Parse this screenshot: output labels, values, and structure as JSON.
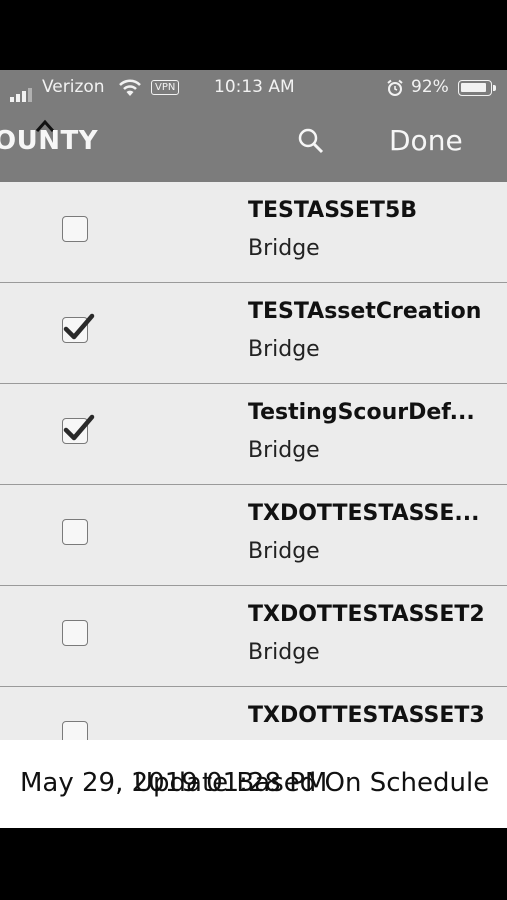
{
  "status_bar": {
    "carrier": "Verizon",
    "vpn": "VPN",
    "time": "10:13 AM",
    "battery_pct": "92%",
    "battery_level": 0.92
  },
  "nav": {
    "title": "OUNTY",
    "done_label": "Done"
  },
  "rows": [
    {
      "name": "TESTASSET5B",
      "type": "Bridge",
      "checked": false
    },
    {
      "name": "TESTAssetCreation",
      "type": "Bridge",
      "checked": true
    },
    {
      "name": "TestingScourDef...",
      "type": "Bridge",
      "checked": true
    },
    {
      "name": "TXDOTTESTASSE...",
      "type": "Bridge",
      "checked": false
    },
    {
      "name": "TXDOTTESTASSET2",
      "type": "Bridge",
      "checked": false
    },
    {
      "name": "TXDOTTESTASSET3",
      "type": "",
      "checked": false
    }
  ],
  "footer": {
    "date": "May 29, 2019 01:28 PM",
    "schedule": "Update Based On Schedule"
  }
}
